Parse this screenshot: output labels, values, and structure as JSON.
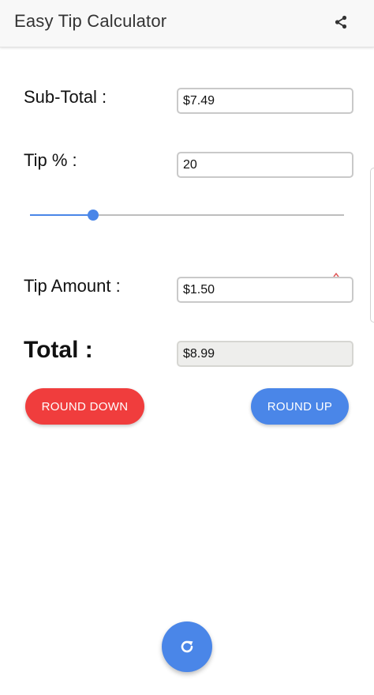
{
  "app_bar": {
    "title": "Easy Tip Calculator",
    "share_icon": "share-icon"
  },
  "subtotal": {
    "label": "Sub-Total :",
    "value": "$7.49"
  },
  "tip_percent": {
    "label": "Tip % :",
    "value": "20",
    "slider_fraction": 0.2
  },
  "tip_amount": {
    "label": "Tip Amount :",
    "value": "$1.50"
  },
  "total": {
    "label": "Total :",
    "value": "$8.99"
  },
  "buttons": {
    "round_down": "ROUND DOWN",
    "round_up": "ROUND UP"
  },
  "fab": {
    "icon": "refresh-icon"
  },
  "colors": {
    "accent_blue": "#4a86e8",
    "danger_red": "#f03d3d",
    "app_bar_bg": "#f8f8f8"
  }
}
